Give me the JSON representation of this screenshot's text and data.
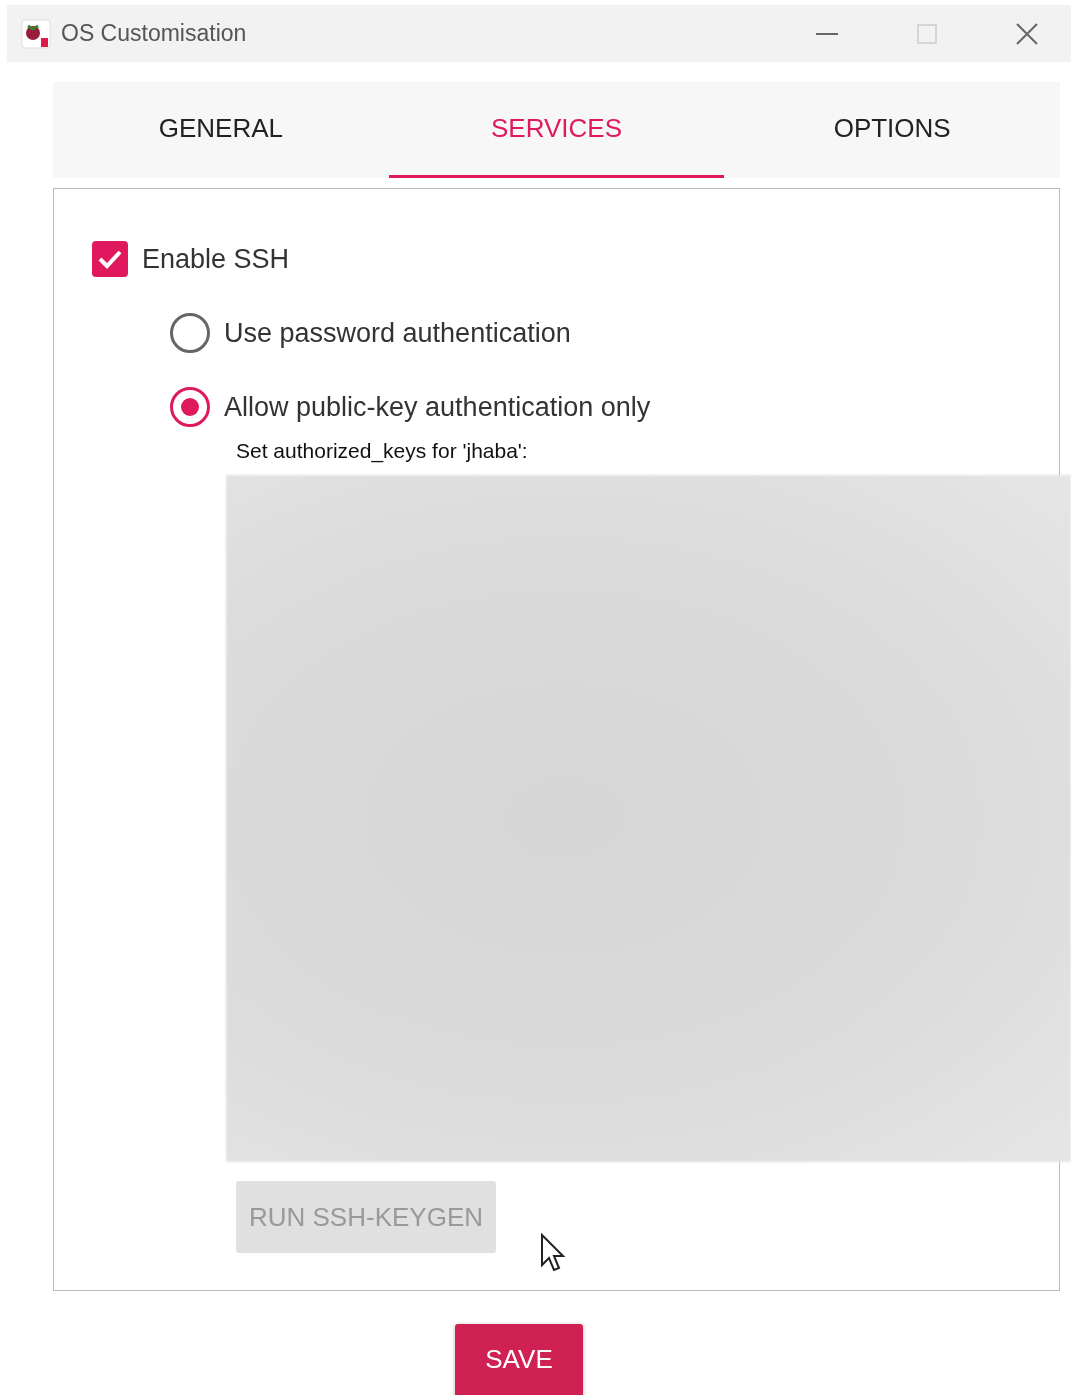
{
  "window": {
    "title": "OS Customisation"
  },
  "tabs": [
    {
      "label": "GENERAL",
      "selected": false
    },
    {
      "label": "SERVICES",
      "selected": true
    },
    {
      "label": "OPTIONS",
      "selected": false
    }
  ],
  "ssh": {
    "label": "Enable SSH",
    "checked": true
  },
  "auth_options": [
    {
      "label": "Use password authentication",
      "selected": false
    },
    {
      "label": "Allow public-key authentication only",
      "selected": true
    }
  ],
  "keys_label": "Set authorized_keys for 'jhaba':",
  "keygen_button": {
    "label": "RUN SSH-KEYGEN",
    "disabled": true
  },
  "save_button": "SAVE"
}
